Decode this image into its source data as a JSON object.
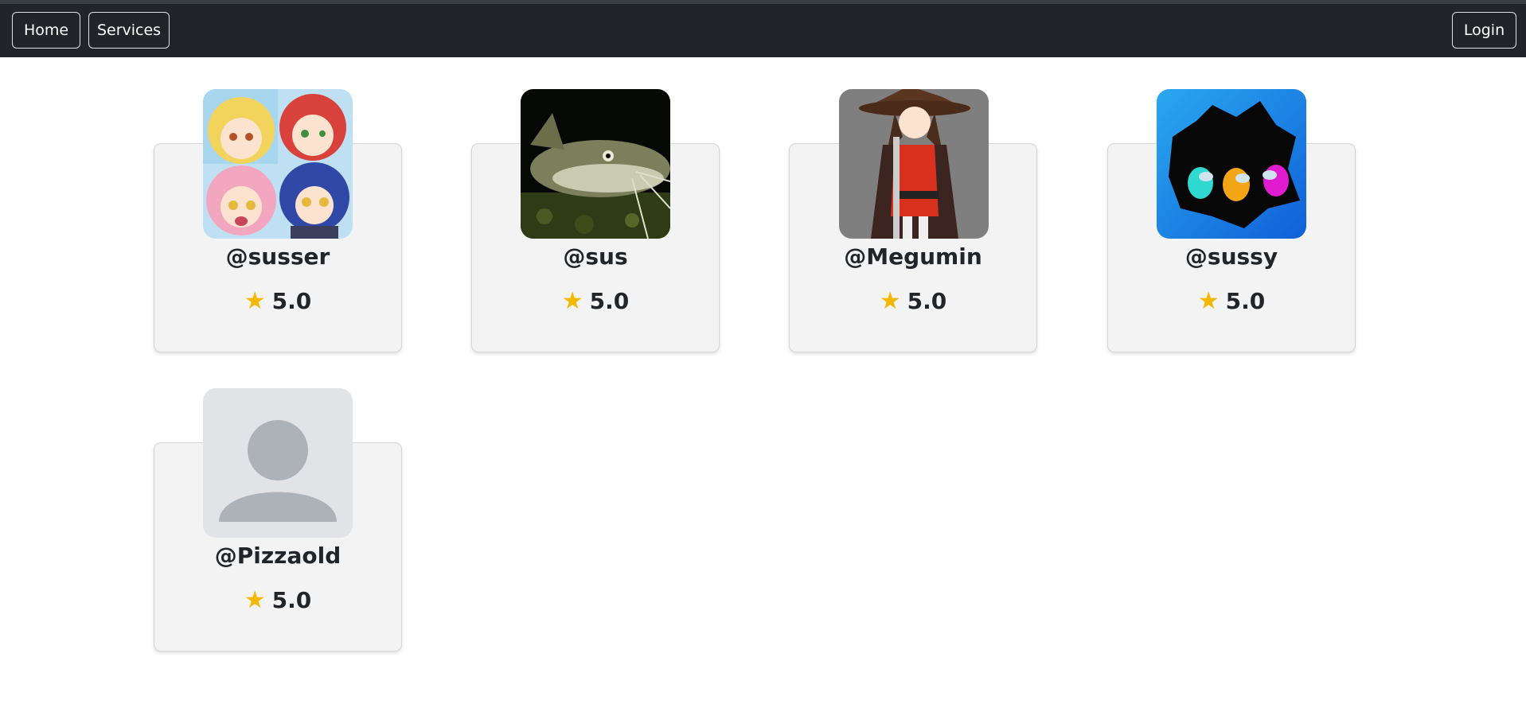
{
  "nav": {
    "home_label": "Home",
    "services_label": "Services",
    "login_label": "Login"
  },
  "colors": {
    "navbar": "#212529",
    "card_bg": "#f3f3f3",
    "star": "#f5b800"
  },
  "profiles": [
    {
      "username": "@susser",
      "rating": "5.0",
      "avatar": "anime-group-avatar"
    },
    {
      "username": "@sus",
      "rating": "5.0",
      "avatar": "catfish-avatar"
    },
    {
      "username": "@Megumin",
      "rating": "5.0",
      "avatar": "witch-avatar"
    },
    {
      "username": "@sussy",
      "rating": "5.0",
      "avatar": "crewmates-avatar"
    },
    {
      "username": "@Pizzaold",
      "rating": "5.0",
      "avatar": "default-user-avatar"
    }
  ],
  "icons": {
    "rating": "star-icon"
  }
}
